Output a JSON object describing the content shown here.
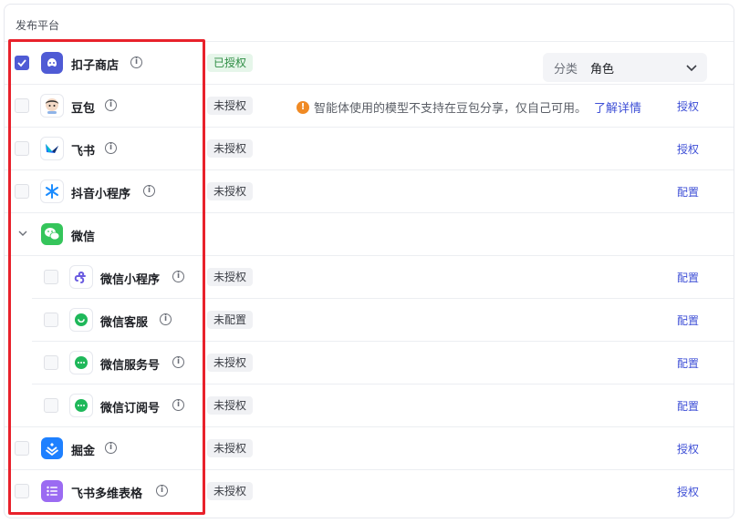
{
  "panel": {
    "title": "发布平台"
  },
  "category_select": {
    "label": "分类",
    "value": "角色"
  },
  "warning": {
    "text": "智能体使用的模型不支持在豆包分享，仅自己可用。",
    "link": "了解详情",
    "icon": "!"
  },
  "info_glyph": "i",
  "platforms": [
    {
      "name": "扣子商店",
      "status": "已授权",
      "status_color": "#2e8d44",
      "action": "",
      "checked": true,
      "icon": "coze-store-icon",
      "icon_color": "#4f5bd5"
    },
    {
      "name": "豆包",
      "status": "未授权",
      "action": "授权",
      "checked": false,
      "icon": "doubao-icon"
    },
    {
      "name": "飞书",
      "status": "未授权",
      "action": "授权",
      "checked": false,
      "icon": "feishu-icon"
    },
    {
      "name": "抖音小程序",
      "status": "未授权",
      "action": "配置",
      "checked": false,
      "icon": "douyin-miniapp-icon"
    },
    {
      "name": "微信",
      "status": "",
      "action": "",
      "group": true,
      "expanded": true,
      "icon": "wechat-icon",
      "icon_color": "#35c55b"
    },
    {
      "name": "微信小程序",
      "status": "未授权",
      "action": "配置",
      "checked": false,
      "child": true,
      "icon": "wechat-miniapp-icon",
      "icon_color": "#6a5be0"
    },
    {
      "name": "微信客服",
      "status": "未配置",
      "action": "配置",
      "checked": false,
      "child": true,
      "icon": "wechat-service-icon",
      "icon_color": "#1fb85a"
    },
    {
      "name": "微信服务号",
      "status": "未授权",
      "action": "配置",
      "checked": false,
      "child": true,
      "icon": "wechat-official-icon",
      "icon_color": "#1fb85a"
    },
    {
      "name": "微信订阅号",
      "status": "未授权",
      "action": "配置",
      "checked": false,
      "child": true,
      "icon": "wechat-subscription-icon",
      "icon_color": "#1fb85a"
    },
    {
      "name": "掘金",
      "status": "未授权",
      "action": "授权",
      "checked": false,
      "icon": "juejin-icon",
      "icon_color": "#1e80ff"
    },
    {
      "name": "飞书多维表格",
      "status": "未授权",
      "action": "授权",
      "checked": false,
      "icon": "feishu-bitable-icon",
      "icon_color": "#9b6bf2"
    }
  ],
  "highlight_color": "#e8212b"
}
